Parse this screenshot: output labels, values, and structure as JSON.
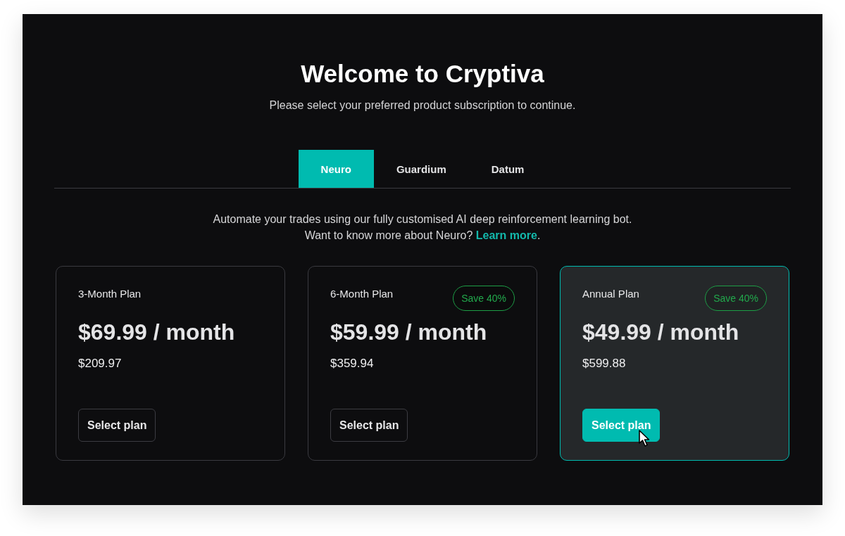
{
  "header": {
    "title": "Welcome to Cryptiva",
    "subtitle": "Please select your preferred product subscription to continue."
  },
  "tabs": [
    {
      "label": "Neuro",
      "selected": true
    },
    {
      "label": "Guardium",
      "selected": false
    },
    {
      "label": "Datum",
      "selected": false
    }
  ],
  "description": {
    "text": "Automate your trades using our fully customised AI deep reinforcement learning bot.",
    "prompt": "Want to know more about Neuro?",
    "link": "Learn more",
    "end": "."
  },
  "plans": [
    {
      "name": "3-Month Plan",
      "price": "$69.99 / month",
      "total": "$209.97",
      "button": "Select plan",
      "selected": false
    },
    {
      "name": "6-Month Plan",
      "badge": "Save 40%",
      "price": "$59.99 / month",
      "total": "$359.94",
      "button": "Select plan",
      "selected": false
    },
    {
      "name": "Annual Plan",
      "badge": "Save 40%",
      "price": "$49.99 / month",
      "total": "$599.88",
      "button": "Select plan",
      "selected": true
    }
  ]
}
